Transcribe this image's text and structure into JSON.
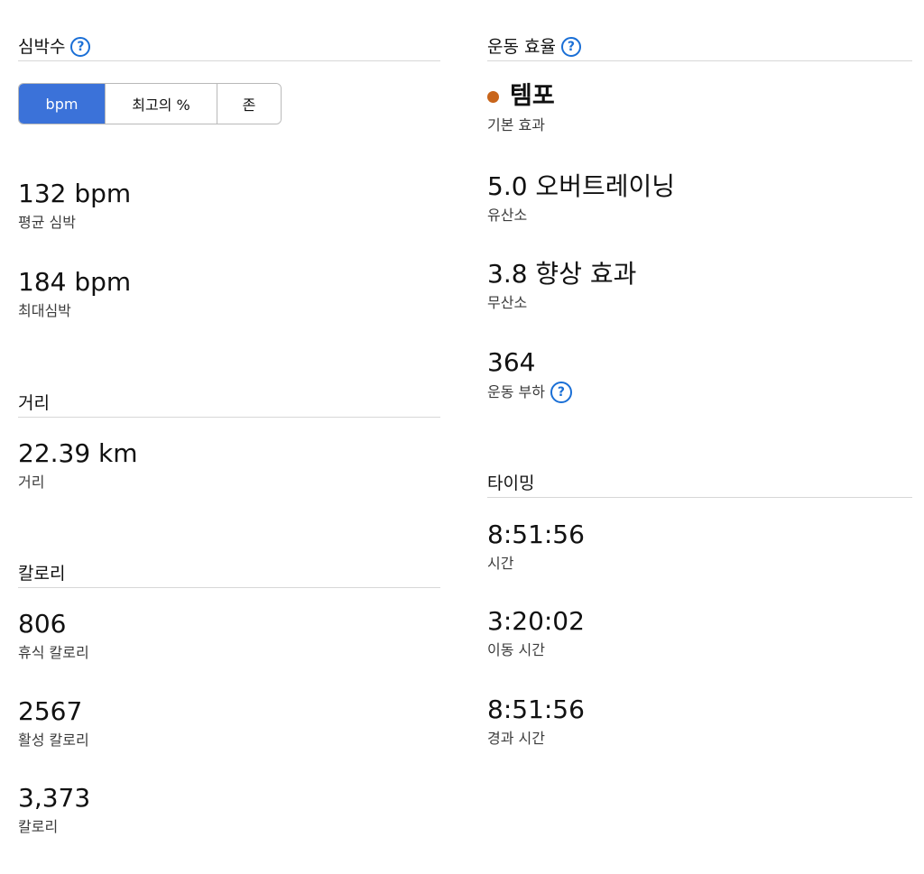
{
  "heart_rate": {
    "title": "심박수",
    "segments": [
      "bpm",
      "최고의 %",
      "존"
    ],
    "active_segment": "bpm",
    "avg_value": "132 bpm",
    "avg_label": "평균 심박",
    "max_value": "184 bpm",
    "max_label": "최대심박"
  },
  "distance": {
    "title": "거리",
    "value": "22.39 km",
    "label": "거리"
  },
  "calories": {
    "title": "칼로리",
    "resting_value": "806",
    "resting_label": "휴식 칼로리",
    "active_value": "2567",
    "active_label": "활성 칼로리",
    "total_value": "3,373",
    "total_label": "칼로리"
  },
  "training_effect": {
    "title": "운동 효율",
    "primary_value": "템포",
    "primary_label": "기본 효과",
    "primary_color": "#c8651b",
    "aerobic_value": "5.0 오버트레이닝",
    "aerobic_label": "유산소",
    "anaerobic_value": "3.8 향상 효과",
    "anaerobic_label": "무산소",
    "load_value": "364",
    "load_label": "운동 부하"
  },
  "timing": {
    "title": "타이밍",
    "time_value": "8:51:56",
    "time_label": "시간",
    "moving_value": "3:20:02",
    "moving_label": "이동 시간",
    "elapsed_value": "8:51:56",
    "elapsed_label": "경과 시간"
  },
  "icons": {
    "help": "question-circle-icon",
    "help_glyph": "?",
    "accent_color": "#1a6fd6",
    "segment_active_color": "#3b72d9"
  }
}
